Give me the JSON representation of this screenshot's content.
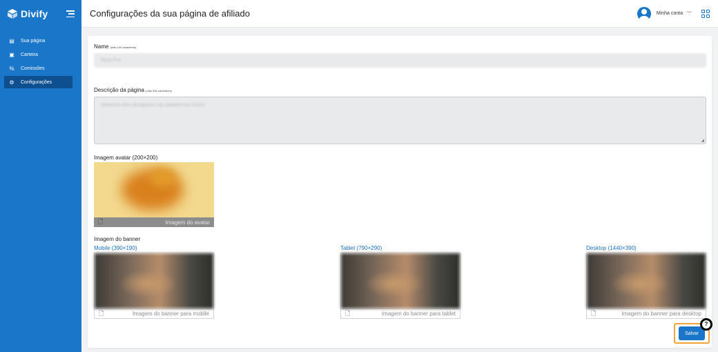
{
  "sidebar": {
    "brand": "Divify",
    "items": [
      {
        "label": "Sua página",
        "icon": "book-icon"
      },
      {
        "label": "Carteira",
        "icon": "wallet-icon"
      },
      {
        "label": "Comissões",
        "icon": "percent-icon"
      },
      {
        "label": "Configurações",
        "icon": "gear-icon",
        "active": true
      }
    ]
  },
  "header": {
    "title": "Configurações da sua página de afiliado",
    "account_label": "Minha conta"
  },
  "form": {
    "name_label": "Name",
    "name_hint": "(máx 100 caracteres)",
    "name_value": "Tania Pro",
    "desc_label": "Descrição da página",
    "desc_hint": "(máx 300 caracteres)",
    "desc_value": "Welcome Aliw divulgados nas plataformas Divify!",
    "avatar_label": "Imagem avatar (200×200)",
    "avatar_upload": "Imagem do avatar",
    "banner_label": "Imagem do banner",
    "banner_mobile_label": "Mobile (390×190)",
    "banner_mobile_upload": "Imagem do banner para mobile",
    "banner_tablet_label": "Tablet (790×290)",
    "banner_tablet_upload": "Imagem do banner para tablet",
    "banner_desktop_label": "Desktop (1440×390)",
    "banner_desktop_upload": "Imagem do banner para desktop",
    "save_label": "Salvar"
  },
  "colors": {
    "sidebar": "#1976c9",
    "active_item": "#0d4f8f",
    "link": "#1a6fc0",
    "highlight": "#f0a43a"
  }
}
